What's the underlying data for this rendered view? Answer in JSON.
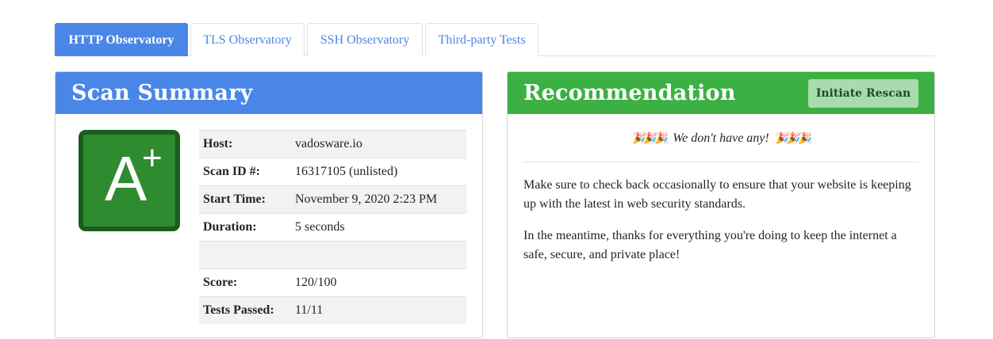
{
  "tabs": [
    {
      "label": "HTTP Observatory",
      "active": true
    },
    {
      "label": "TLS Observatory",
      "active": false
    },
    {
      "label": "SSH Observatory",
      "active": false
    },
    {
      "label": "Third-party Tests",
      "active": false
    }
  ],
  "scan_summary": {
    "title": "Scan Summary",
    "grade": {
      "letter": "A",
      "modifier": "+",
      "color": "#2e8b30"
    },
    "rows": [
      {
        "label": "Host:",
        "value": "vadosware.io"
      },
      {
        "label": "Scan ID #:",
        "value": "16317105 (unlisted)"
      },
      {
        "label": "Start Time:",
        "value": "November 9, 2020 2:23 PM"
      },
      {
        "label": "Duration:",
        "value": "5 seconds"
      },
      {
        "label": "",
        "value": ""
      },
      {
        "label": "Score:",
        "value": "120/100"
      },
      {
        "label": "Tests Passed:",
        "value": "11/11"
      }
    ]
  },
  "recommendation": {
    "title": "Recommendation",
    "rescan_label": "Initiate Rescan",
    "headline": "We don't have any!",
    "emoji": "🎉🎉🎉",
    "paragraphs": [
      "Make sure to check back occasionally to ensure that your website is keeping up with the latest in web security standards.",
      "In the meantime, thanks for everything you're doing to keep the internet a safe, secure, and private place!"
    ]
  },
  "colors": {
    "http_blue": "#4a86e8",
    "recommendation_green": "#3cb043",
    "rescan_button": "#a8dbad"
  }
}
